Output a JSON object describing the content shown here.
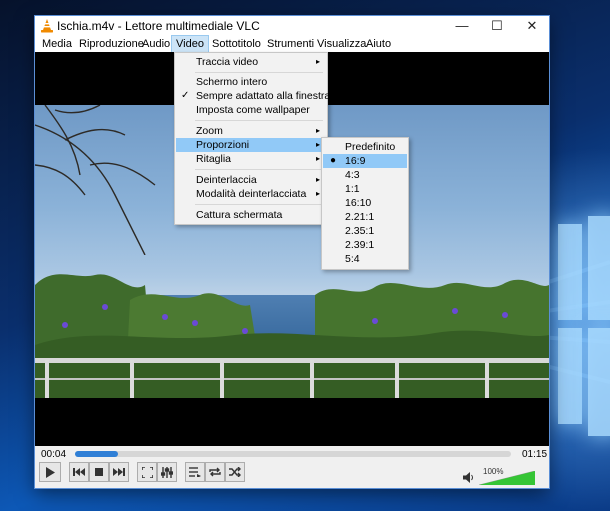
{
  "window": {
    "title": "Ischia.m4v - Lettore multimediale VLC",
    "minimize": "—",
    "maximize": "☐",
    "close": "✕"
  },
  "menubar": [
    "Media",
    "Riproduzione",
    "Audio",
    "Video",
    "Sottotitolo",
    "Strumenti",
    "Visualizza",
    "Aiuto"
  ],
  "video_menu": {
    "items": [
      "Traccia video",
      "Schermo intero",
      "Sempre adattato alla finestra",
      "Imposta come wallpaper",
      "Zoom",
      "Proporzioni",
      "Ritaglia",
      "Deinterlaccia",
      "Modalità deinterlacciata",
      "Cattura schermata"
    ],
    "check_mark": "✓",
    "submenu_arrow": "▸"
  },
  "aspect_submenu": {
    "items": [
      "Predefinito",
      "16:9",
      "4:3",
      "1:1",
      "16:10",
      "2.21:1",
      "2.35:1",
      "2.39:1",
      "5:4"
    ],
    "selected_index": 1,
    "bullet": "●"
  },
  "playback": {
    "elapsed": "00:04",
    "total": "01:15",
    "progress_fraction": 0.053,
    "volume_label": "100%",
    "volume_fraction": 1.0
  },
  "icons": [
    "vlc-cone-icon",
    "play-icon",
    "previous-icon",
    "stop-icon",
    "next-icon",
    "fullscreen-icon",
    "extended-settings-icon",
    "playlist-icon",
    "loop-icon",
    "shuffle-icon",
    "speaker-icon"
  ],
  "colors": {
    "accent": "#2f7fd6",
    "highlight": "#91c9f7",
    "menu_active": "#cce4f7",
    "vlc_orange": "#f08a00",
    "volume_green": "#35c535"
  }
}
